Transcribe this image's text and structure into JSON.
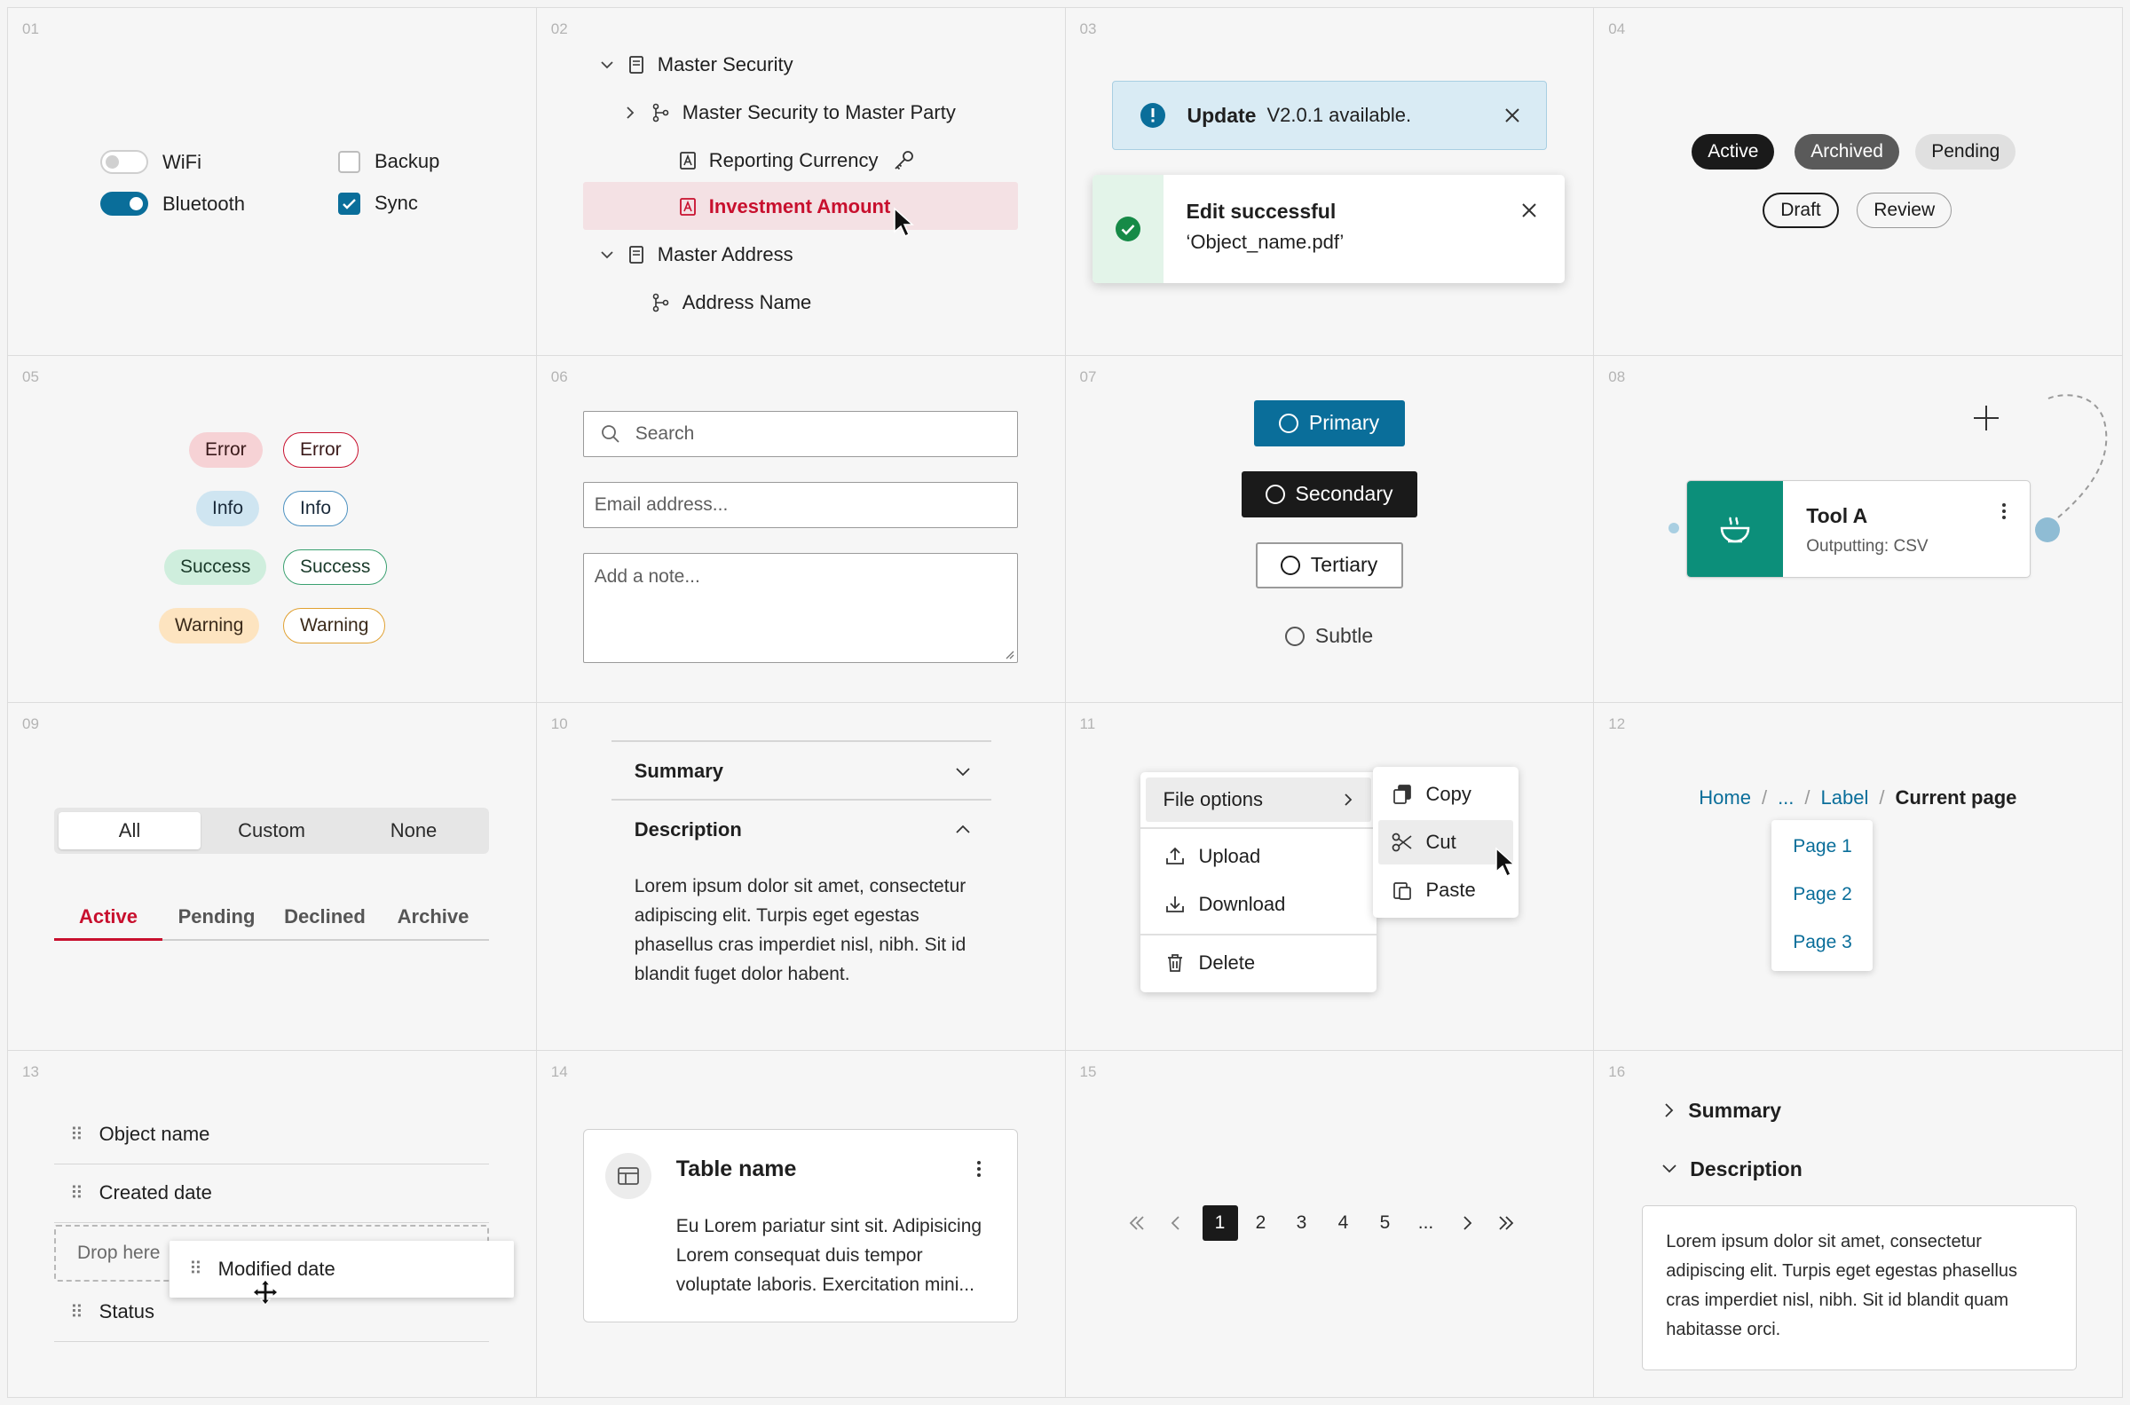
{
  "cells": [
    "01",
    "02",
    "03",
    "04",
    "05",
    "06",
    "07",
    "08",
    "09",
    "10",
    "11",
    "12",
    "13",
    "14",
    "15",
    "16"
  ],
  "c01": {
    "wifi": "WiFi",
    "bluetooth": "Bluetooth",
    "backup": "Backup",
    "sync": "Sync"
  },
  "c02": {
    "items": [
      "Master Security",
      "Master Security to Master Party",
      "Reporting Currency",
      "Investment Amount",
      "Master Address",
      "Address Name"
    ]
  },
  "c03": {
    "update_title": "Update",
    "update_text": "V2.0.1 available.",
    "success_title": "Edit successful",
    "success_text": "‘Object_name.pdf’"
  },
  "c04": {
    "chips": [
      "Active",
      "Archived",
      "Pending",
      "Draft",
      "Review"
    ]
  },
  "c05": {
    "chips": [
      "Error",
      "Error",
      "Info",
      "Info",
      "Success",
      "Success",
      "Warning",
      "Warning"
    ]
  },
  "c06": {
    "search_placeholder": "Search",
    "email_placeholder": "Email address...",
    "note_placeholder": "Add a note..."
  },
  "c07": {
    "primary": "Primary",
    "secondary": "Secondary",
    "tertiary": "Tertiary",
    "subtle": "Subtle"
  },
  "c08": {
    "title": "Tool A",
    "subtitle": "Outputting: CSV"
  },
  "c09": {
    "segments": [
      "All",
      "Custom",
      "None"
    ],
    "tabs": [
      "Active",
      "Pending",
      "Declined",
      "Archive"
    ]
  },
  "c10": {
    "summary": "Summary",
    "description": "Description",
    "body": "Lorem ipsum dolor sit amet, consectetur adipiscing elit. Turpis eget egestas phasellus cras imperdiet nisl, nibh. Sit id blandit fuget dolor habent."
  },
  "c11": {
    "file_options": "File options",
    "upload": "Upload",
    "download": "Download",
    "delete": "Delete",
    "copy": "Copy",
    "cut": "Cut",
    "paste": "Paste"
  },
  "c12": {
    "home": "Home",
    "ellipsis": "...",
    "label": "Label",
    "current": "Current page",
    "pages": [
      "Page 1",
      "Page 2",
      "Page 3"
    ]
  },
  "c13": {
    "rows": [
      "Object name",
      "Created date",
      "Status"
    ],
    "drop": "Drop here",
    "dragging": "Modified date"
  },
  "c14": {
    "title": "Table name",
    "body": "Eu Lorem pariatur sint sit. Adipisicing Lorem consequat duis tempor voluptate laboris. Exercitation mini..."
  },
  "c15": {
    "pages": [
      "1",
      "2",
      "3",
      "4",
      "5",
      "..."
    ]
  },
  "c16": {
    "summary": "Summary",
    "description": "Description",
    "body": "Lorem ipsum dolor sit amet, consectetur adipiscing elit. Turpis eget egestas phasellus cras imperdiet nisl, nibh. Sit id blandit quam habitasse orci."
  },
  "colors": {
    "accent": "#0a6e9a",
    "danger": "#c8102e",
    "teal": "#0c8f7a",
    "selection": "#f4e1e4"
  }
}
